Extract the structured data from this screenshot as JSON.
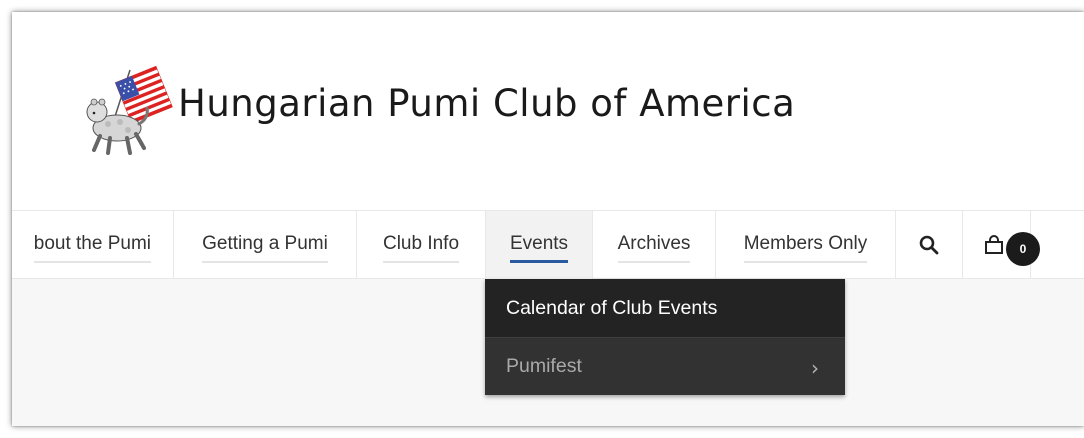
{
  "site": {
    "title": "Hungarian Pumi Club of America"
  },
  "nav": {
    "items": [
      {
        "label": "bout the Pumi"
      },
      {
        "label": "Getting a Pumi"
      },
      {
        "label": "Club Info"
      },
      {
        "label": "Events",
        "active": true
      },
      {
        "label": "Archives"
      },
      {
        "label": "Members Only"
      }
    ],
    "search_icon": "search-icon",
    "cart_icon": "shopping-bag-icon",
    "cart_count": "0"
  },
  "dropdown": {
    "items": [
      {
        "label": "Calendar of Club Events"
      },
      {
        "label": "Pumifest",
        "has_submenu": true,
        "chevron": "›"
      }
    ]
  },
  "colors": {
    "dropdown_bg": "#2f2f2f",
    "active_underline": "#2a5aa0",
    "badge_bg": "#1b1b1b"
  }
}
